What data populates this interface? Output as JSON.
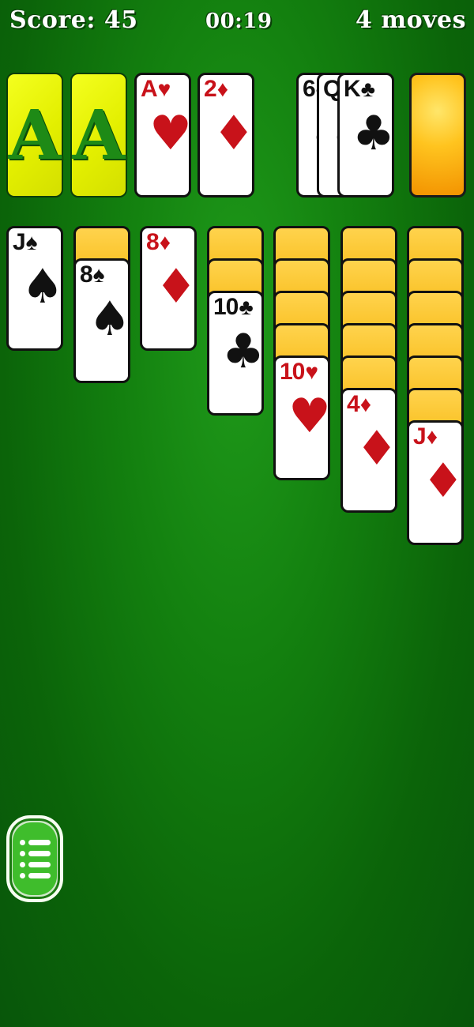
{
  "hud": {
    "score": "Score: 45",
    "timer": "00:19",
    "moves": "4 moves"
  },
  "foundations": [
    {
      "kind": "empty",
      "label": "A"
    },
    {
      "kind": "empty",
      "label": "A"
    },
    {
      "kind": "card",
      "rank": "A",
      "suit": "♥",
      "color": "red"
    },
    {
      "kind": "card",
      "rank": "2",
      "suit": "♦",
      "color": "red"
    }
  ],
  "waste": [
    {
      "rank": "6",
      "suit": "♣",
      "color": "black"
    },
    {
      "rank": "Q",
      "suit": "♣",
      "color": "black"
    },
    {
      "rank": "K",
      "suit": "♣",
      "color": "black"
    }
  ],
  "tableau": [
    {
      "hidden": 0,
      "top": {
        "rank": "J",
        "suit": "♠",
        "color": "black"
      }
    },
    {
      "hidden": 1,
      "top": {
        "rank": "8",
        "suit": "♠",
        "color": "black"
      }
    },
    {
      "hidden": 0,
      "top": {
        "rank": "8",
        "suit": "♦",
        "color": "red"
      }
    },
    {
      "hidden": 2,
      "top": {
        "rank": "10",
        "suit": "♣",
        "color": "black"
      }
    },
    {
      "hidden": 4,
      "top": {
        "rank": "10",
        "suit": "♥",
        "color": "red"
      }
    },
    {
      "hidden": 5,
      "top": {
        "rank": "4",
        "suit": "♦",
        "color": "red"
      }
    },
    {
      "hidden": 6,
      "top": {
        "rank": "J",
        "suit": "♦",
        "color": "red"
      }
    }
  ],
  "colors": {
    "felt": "#13800f",
    "slot": "#e3ef00",
    "card_back": "#f5b50a",
    "red_suit": "#c8121a"
  },
  "menu": {
    "icon": "menu-list-icon"
  }
}
